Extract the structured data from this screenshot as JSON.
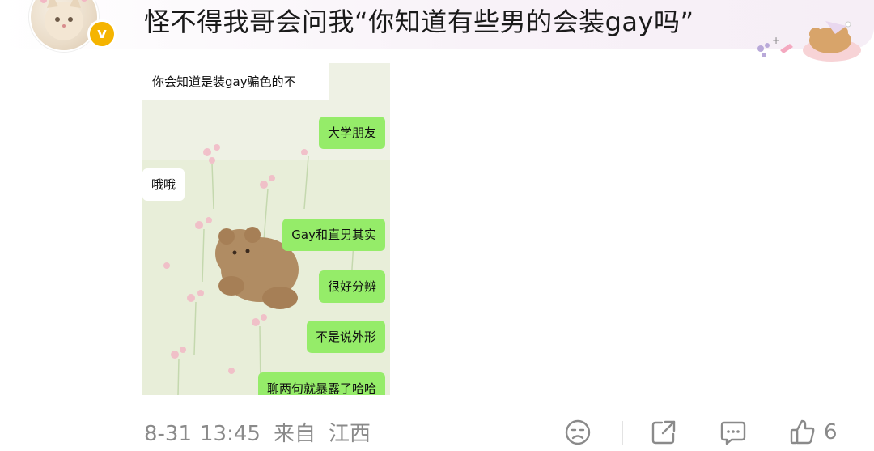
{
  "comment": {
    "text": "怪不得我哥会问我“你知道有些男的会装gay吗”",
    "badge": "v"
  },
  "chat": {
    "messages": [
      {
        "side": "left",
        "text": "你会知道是装gay骗色的不"
      },
      {
        "side": "right",
        "text": "大学朋友"
      },
      {
        "side": "left",
        "text": "哦哦"
      },
      {
        "side": "right",
        "text": "Gay和直男其实"
      },
      {
        "side": "right",
        "text": "很好分辨"
      },
      {
        "side": "right",
        "text": "不是说外形"
      },
      {
        "side": "right",
        "text": "聊两句就暴露了哈哈"
      }
    ]
  },
  "footer": {
    "date": "8-31",
    "time": "13:45",
    "source": "来自",
    "location": "江西",
    "like_count": "6",
    "icons": [
      "dislike-face-icon",
      "share-icon",
      "comment-icon",
      "thumbs-up-icon"
    ]
  },
  "colors": {
    "bubble_green": "#95ec69",
    "badge_gold": "#f5b400",
    "meta_gray": "#8a8a8a"
  }
}
